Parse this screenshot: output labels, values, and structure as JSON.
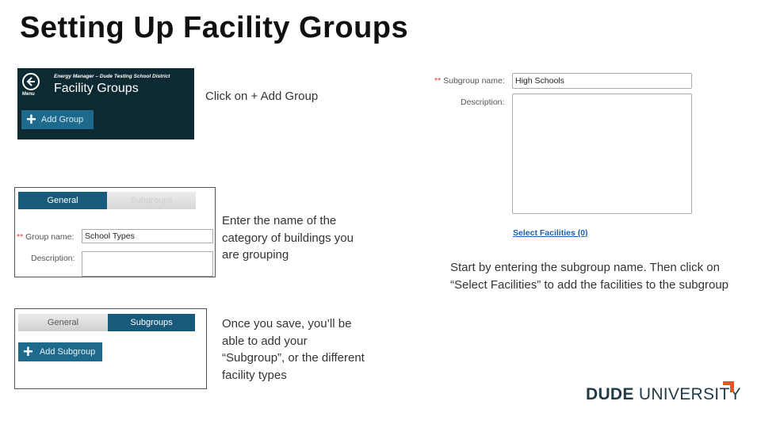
{
  "slide": {
    "title": "Setting Up Facility Groups"
  },
  "step1": {
    "menu_label": "Menu",
    "app_header": "Energy Manager – Dude Testing School District",
    "page_title": "Facility Groups",
    "add_group_label": "Add Group",
    "caption": "Click on + Add Group"
  },
  "step2": {
    "tab_general": "General",
    "tab_subgroups": "Subgroups",
    "required_mark": "**",
    "group_name_label": "Group name:",
    "group_name_value": "School Types",
    "description_label": "Description:",
    "caption": "Enter the name of the category of buildings you are grouping"
  },
  "step3": {
    "tab_general": "General",
    "tab_subgroups": "Subgroups",
    "add_subgroup_label": "Add Subgroup",
    "caption": "Once you save, you’ll be able to add your “Subgroup”, or the different facility types"
  },
  "step4": {
    "required_mark": "**",
    "subgroup_name_label": "Subgroup name:",
    "subgroup_name_value": "High Schools",
    "description_label": "Description:",
    "select_facilities_link": "Select Facilities (0)",
    "caption": "Start by entering the subgroup name. Then click on “Select Facilities” to add the facilities to the subgroup"
  },
  "logo": {
    "bold": "DUDE",
    "light": "UNIVERSITY",
    "accent_color": "#e8542a"
  },
  "colors": {
    "nav_dark": "#0d2a33",
    "button_blue": "#1e6a8c",
    "tab_active": "#195a7a",
    "link_blue": "#1e5fa8"
  }
}
